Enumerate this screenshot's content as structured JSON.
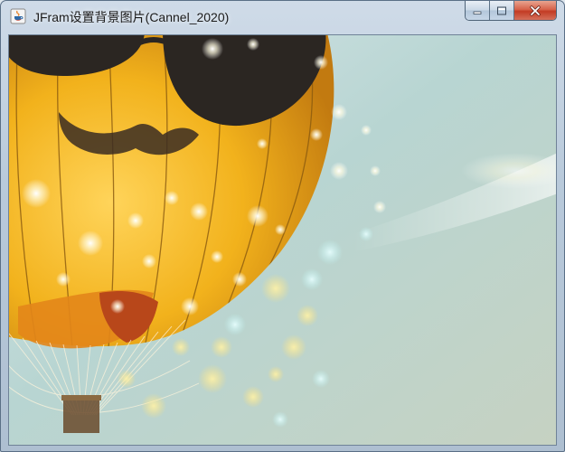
{
  "window": {
    "title": "JFram设置背景图片(Cannel_2020)",
    "icon": "java-icon"
  },
  "controls": {
    "minimize_icon": "minimize-icon",
    "maximize_icon": "maximize-icon",
    "close_icon": "close-icon"
  },
  "background_image": {
    "subject": "hot air balloon with sunglasses and mustache on pale teal sky with bokeh lights",
    "colors": {
      "balloon_yellow": "#f2b21c",
      "balloon_orange": "#e3861a",
      "sky": "#b9d6cf",
      "dark": "#2b2622"
    }
  }
}
